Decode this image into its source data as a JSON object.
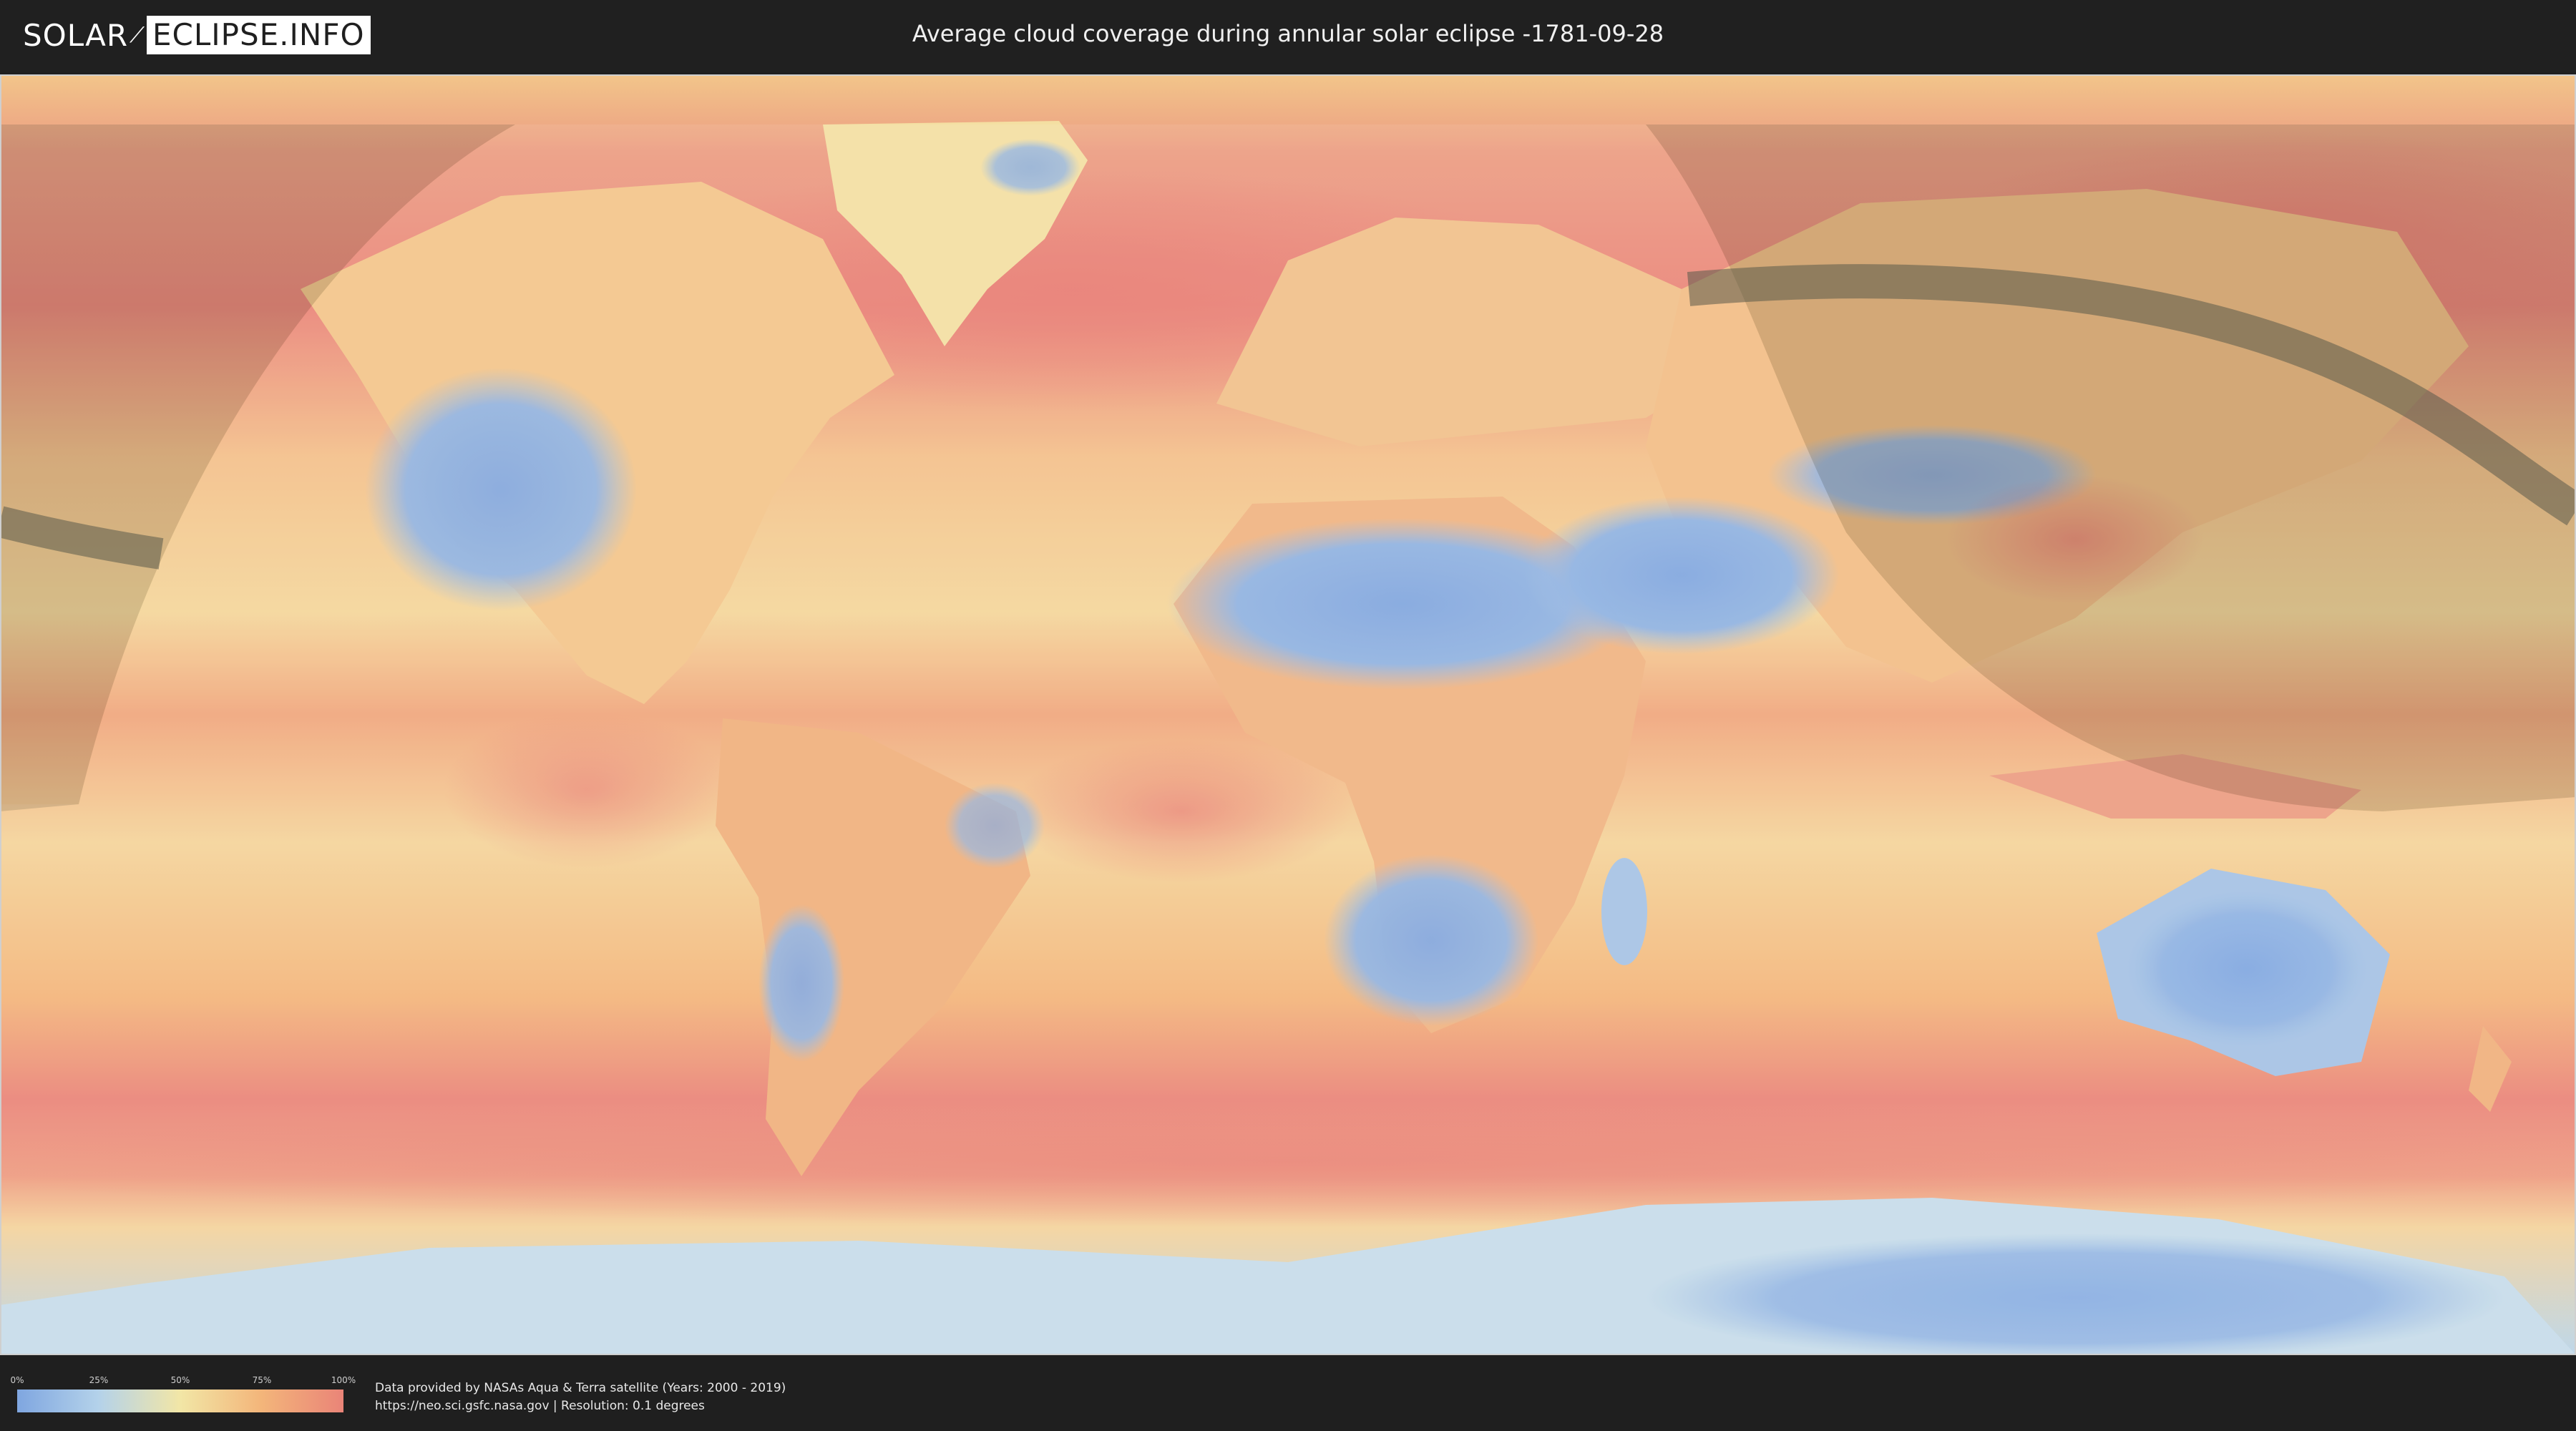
{
  "header": {
    "logo_part1": "SOLAR",
    "logo_part2": "ECLIPSE.INFO",
    "title": "Average cloud coverage during annular solar eclipse -1781-09-28"
  },
  "legend": {
    "ticks": [
      "0%",
      "25%",
      "50%",
      "75%",
      "100%"
    ],
    "colors": [
      "#7fa6e0",
      "#b4d2ea",
      "#f2e6a6",
      "#f3b57a",
      "#ea8478"
    ]
  },
  "footer": {
    "credit_line1": "Data provided by NASAs Aqua & Terra satellite (Years: 2000 - 2019)",
    "credit_line2": "https://neo.sci.gsfc.nasa.gov | Resolution: 0.1 degrees"
  },
  "map": {
    "ocean_color": "#f3b57a",
    "clear_color": "#7fa6e0",
    "cloudy_color": "#ea8478",
    "shadow_path_color": "#5a5a4a"
  }
}
